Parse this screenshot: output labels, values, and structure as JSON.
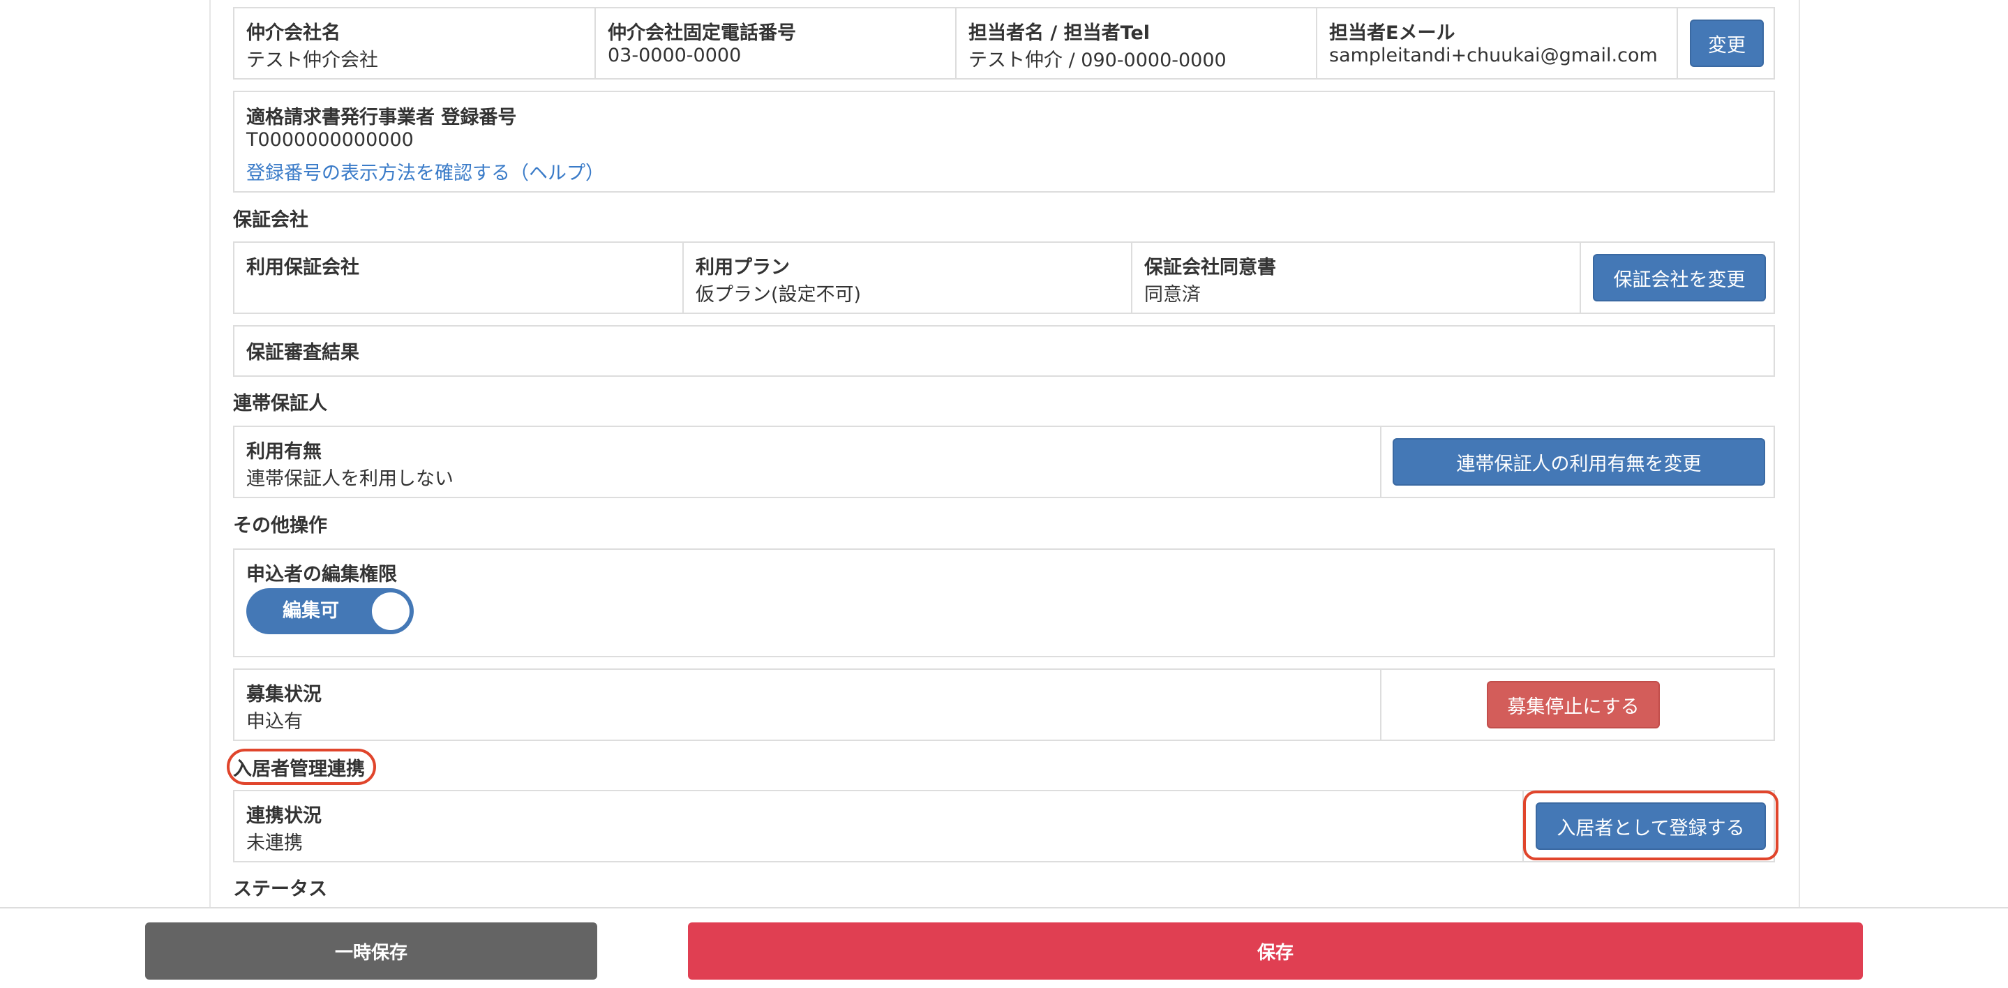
{
  "broker": {
    "company_label": "仲介会社名",
    "company_value": "テスト仲介会社",
    "phone_label": "仲介会社固定電話番号",
    "phone_value": "03-0000-0000",
    "contact_label": "担当者名 / 担当者Tel",
    "contact_value": "テスト仲介 / 090-0000-0000",
    "email_label": "担当者Eメール",
    "email_value": "sampleitandi+chuukai@gmail.com",
    "change_button": "変更"
  },
  "invoice": {
    "label": "適格請求書発行事業者 登録番号",
    "value": "T0000000000000",
    "help_link": "登録番号の表示方法を確認する（ヘルプ）"
  },
  "guarantee": {
    "section_title": "保証会社",
    "company_label": "利用保証会社",
    "company_value": "",
    "plan_label": "利用プラン",
    "plan_value": "仮プラン(設定不可)",
    "consent_label": "保証会社同意書",
    "consent_value": "同意済",
    "change_button": "保証会社を変更",
    "result_label": "保証審査結果"
  },
  "joint_guarantor": {
    "section_title": "連帯保証人",
    "usage_label": "利用有無",
    "usage_value": "連帯保証人を利用しない",
    "change_button": "連帯保証人の利用有無を変更"
  },
  "other": {
    "section_title": "その他操作",
    "edit_permission_label": "申込者の編集権限",
    "toggle_label": "編集可",
    "recruit_label": "募集状況",
    "recruit_value": "申込有",
    "stop_button": "募集停止にする"
  },
  "resident_link": {
    "section_title": "入居者管理連携",
    "status_label": "連携状況",
    "status_value": "未連携",
    "register_button": "入居者として登録する"
  },
  "status": {
    "section_title": "ステータス"
  },
  "footer": {
    "temp_save": "一時保存",
    "save": "保存"
  },
  "colors": {
    "primary": "#4478b6",
    "danger": "#d35d5a",
    "save": "#e03f52",
    "temp_save": "#646464",
    "highlight": "#e0452c"
  }
}
